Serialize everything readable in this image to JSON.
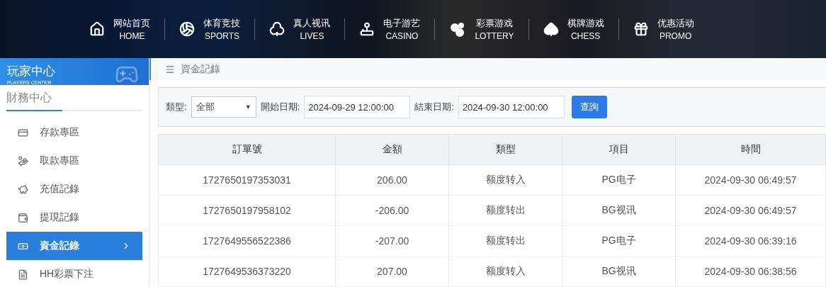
{
  "nav": [
    {
      "kind": "home",
      "title": "网站首页",
      "subtitle": "HOME"
    },
    {
      "kind": "sports",
      "title": "体育竞技",
      "subtitle": "SPORTS"
    },
    {
      "kind": "lives",
      "title": "真人视讯",
      "subtitle": "LIVES"
    },
    {
      "kind": "casino",
      "title": "电子游艺",
      "subtitle": "CASINO"
    },
    {
      "kind": "lottery",
      "title": "彩票游戏",
      "subtitle": "LOTTERY"
    },
    {
      "kind": "chess",
      "title": "棋牌游戏",
      "subtitle": "CHESS"
    },
    {
      "kind": "promo",
      "title": "优惠活动",
      "subtitle": "PROMO"
    }
  ],
  "sidebar": {
    "title": "玩家中心",
    "subtitle": "PLAYERS CENTER",
    "section": "財務中心",
    "items": [
      {
        "kind": "card",
        "label": "存款專區",
        "selected": false
      },
      {
        "kind": "hand",
        "label": "取款專區",
        "selected": false
      },
      {
        "kind": "bag",
        "label": "充值記錄",
        "selected": false
      },
      {
        "kind": "wallet",
        "label": "提現記錄",
        "selected": false
      },
      {
        "kind": "cash",
        "label": "資金記錄",
        "selected": true
      },
      {
        "kind": "doc",
        "label": "HH彩票下注",
        "selected": false
      }
    ]
  },
  "breadcrumb": "資金記錄",
  "filter": {
    "type_label": "類型:",
    "type_value": "全部",
    "type_arrow": "▼",
    "start_label": "開始日期:",
    "start_value": "2024-09-29 12:00:00",
    "end_label": "結束日期:",
    "end_value": "2024-09-30 12:00:00",
    "button": "查詢"
  },
  "table": {
    "columns": [
      "訂單號",
      "金額",
      "類型",
      "項目",
      "時間"
    ],
    "rows": [
      [
        "1727650197353031",
        "206.00",
        "额度转入",
        "PG电子",
        "2024-09-30 06:49:57"
      ],
      [
        "1727650197958102",
        "-206.00",
        "额度转出",
        "BG视讯",
        "2024-09-30 06:49:57"
      ],
      [
        "1727649556522386",
        "-207.00",
        "额度转出",
        "PG电子",
        "2024-09-30 06:39:16"
      ],
      [
        "1727649536373220",
        "207.00",
        "额度转入",
        "BG视讯",
        "2024-09-30 06:38:56"
      ]
    ]
  }
}
